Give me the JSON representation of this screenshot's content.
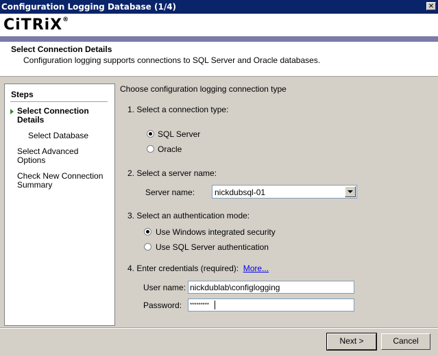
{
  "window": {
    "title": "Configuration Logging Database (1/4)",
    "close_glyph": "✕"
  },
  "header": {
    "logo": "CiTRiX",
    "logo_mark": "®",
    "step_title": "Select Connection Details",
    "step_desc": "Configuration logging supports connections to SQL Server and Oracle databases."
  },
  "steps": {
    "heading": "Steps",
    "items": [
      {
        "label": "Select Connection Details",
        "current": true
      },
      {
        "label": "Select Database",
        "current": false
      },
      {
        "label": "Select Advanced Options",
        "current": false
      },
      {
        "label": "Check New Connection Summary",
        "current": false
      }
    ]
  },
  "form": {
    "heading": "Choose configuration logging connection type",
    "section1": "1. Select a connection type:",
    "conn_types": [
      {
        "label": "SQL Server",
        "selected": true
      },
      {
        "label": "Oracle",
        "selected": false
      }
    ],
    "section2": "2. Select a server name:",
    "server_label": "Server name:",
    "server_value": "nickdubsql-01",
    "section3": "3. Select an authentication mode:",
    "auth_modes": [
      {
        "label": "Use Windows integrated security",
        "selected": true
      },
      {
        "label": "Use SQL Server authentication",
        "selected": false
      }
    ],
    "section4": "4. Enter credentials (required):",
    "more_link": "More...",
    "username_label": "User name:",
    "username_value": "nickdublab\\configlogging",
    "password_label": "Password:",
    "password_value": "*********"
  },
  "buttons": {
    "next": "Next >",
    "cancel": "Cancel"
  },
  "colors": {
    "titlebar": "#0a246a",
    "accent_bar": "#7b7aa8",
    "dialog_bg": "#d4d0c8",
    "step_arrow": "#2e8b2e"
  }
}
